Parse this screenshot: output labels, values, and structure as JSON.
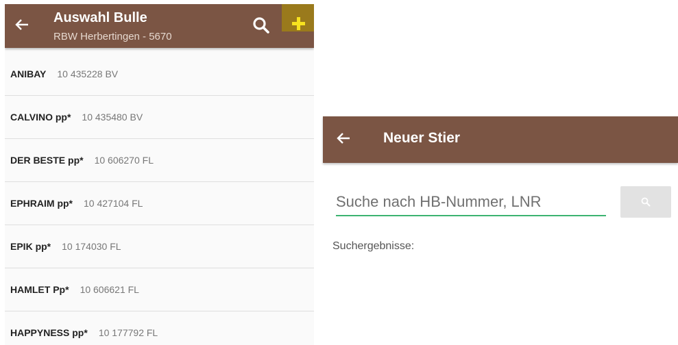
{
  "left_screen": {
    "title": "Auswahl Bulle",
    "subtitle": "RBW Herbertingen - 5670",
    "bulls": [
      {
        "name": "ANIBAY",
        "id": "10 435228 BV"
      },
      {
        "name": "CALVINO pp*",
        "id": "10 435480 BV"
      },
      {
        "name": "DER BESTE pp*",
        "id": "10 606270 FL"
      },
      {
        "name": "EPHRAIM pp*",
        "id": "10 427104 FL"
      },
      {
        "name": "EPIK pp*",
        "id": "10 174030 FL"
      },
      {
        "name": "HAMLET Pp*",
        "id": "10 606621 FL"
      },
      {
        "name": "HAPPYNESS pp*",
        "id": "10 177792 FL"
      }
    ]
  },
  "right_screen": {
    "title": "Neuer Stier",
    "search_placeholder": "Suche nach HB-Nummer, LNR",
    "results_label": "Suchergebnisse:"
  },
  "colors": {
    "appbar": "#7b5544",
    "add_button": "#9a7a1c",
    "plus": "#f7e21f",
    "input_underline": "#3cb371"
  },
  "icons": {
    "back": "arrow-left-icon",
    "search": "search-icon",
    "add": "plus-icon"
  }
}
